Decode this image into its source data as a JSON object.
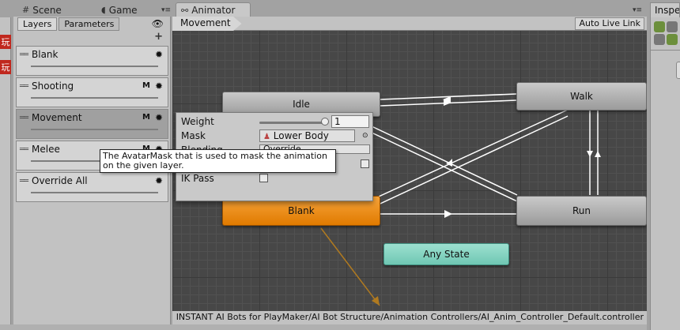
{
  "tabs": {
    "scene": "Scene",
    "game": "Game",
    "animator": "Animator",
    "inspector": "Inspe"
  },
  "left_chips": [
    "玩",
    "玩"
  ],
  "left_panel": {
    "tab_layers": "Layers",
    "tab_parameters": "Parameters",
    "layers": [
      {
        "name": "Blank",
        "badge": ""
      },
      {
        "name": "Shooting",
        "badge": "M"
      },
      {
        "name": "Movement",
        "badge": "M"
      },
      {
        "name": "Melee",
        "badge": "M"
      },
      {
        "name": "Override All",
        "badge": ""
      }
    ]
  },
  "breadcrumb": "Movement",
  "auto_live_link": "Auto Live Link",
  "states": {
    "idle": "Idle",
    "walk": "Walk",
    "blank": "Blank",
    "run": "Run",
    "any_state": "Any State"
  },
  "layer_settings": {
    "weight_label": "Weight",
    "weight_value": "1",
    "weight_fraction": 1.0,
    "mask_label": "Mask",
    "mask_value": "Lower Body",
    "blending_label": "Blending",
    "blending_value": "Override",
    "ik_pass_label": "IK Pass"
  },
  "tooltip": "The AvatarMask that is used to mask the animation on the given layer.",
  "footer_path": "INSTANT AI Bots for PlayMaker/AI Bot Structure/Animation Controllers/AI_Anim_Controller_Default.controller",
  "colors": {
    "default_state": "#b2b2b2",
    "default_state_fill": "#e07a00",
    "any_state": "#6fc7b3",
    "grid_bg": "#474747"
  }
}
